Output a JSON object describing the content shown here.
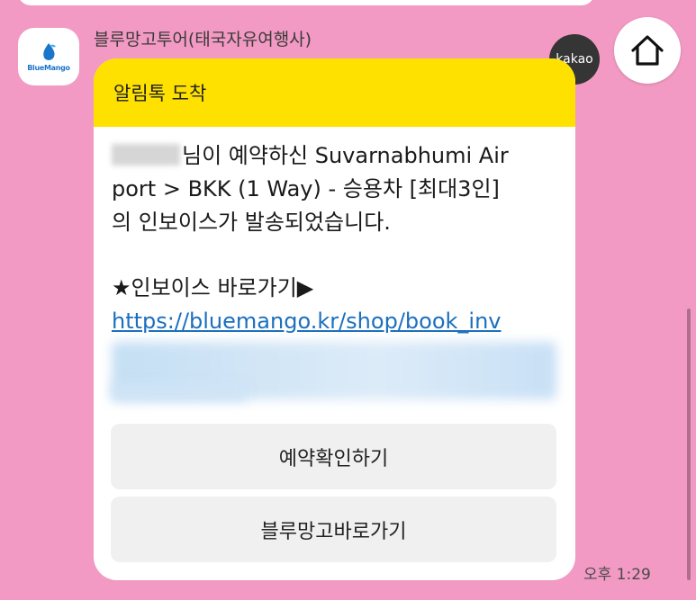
{
  "chat": {
    "sender_name": "블루망고투어(태국자유여행사)",
    "avatar_logo_text": "BlueMango",
    "kakao_badge": "kakao",
    "timestamp": "오후 1:29"
  },
  "message": {
    "header_title": "알림톡 도착",
    "line1_rest": "님이 예약하신 Suvarnabhumi Air",
    "line2": "port > BKK (1 Way) - 승용차 [최대3인]",
    "line3": "의 인보이스가 발송되었습니다.",
    "invoice_label": "★인보이스 바로가기▶",
    "link_text": "https://bluemango.kr/shop/book_inv"
  },
  "buttons": {
    "confirm_label": "예약확인하기",
    "bluemango_label": "블루망고바로가기"
  },
  "icons": {
    "home": "home-icon",
    "avatar": "bluemango-logo"
  },
  "colors": {
    "background": "#f29ac3",
    "header_yellow": "#ffe100",
    "link_blue": "#1b6fbf",
    "button_gray": "#f0f0f0"
  }
}
